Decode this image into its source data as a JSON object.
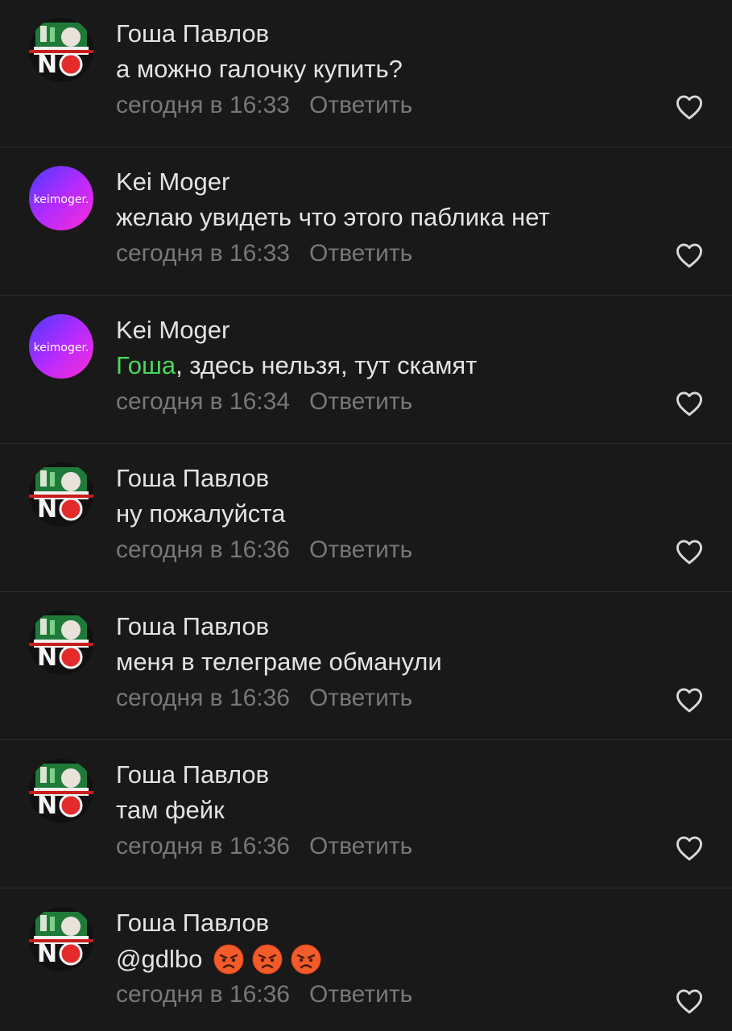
{
  "reply_label": "Ответить",
  "mention_color": "#4bd75b",
  "comments": [
    {
      "author": "Гоша Павлов",
      "avatar_icon": "no-sign-avatar-icon",
      "text": "а можно галочку купить?",
      "time": "сегодня в 16:33"
    },
    {
      "author": "Kei Moger",
      "avatar_icon": "keimoger-logo-avatar-icon",
      "avatar_text": "keimoger.",
      "text": "желаю увидеть что этого паблика нет",
      "time": "сегодня в 16:33"
    },
    {
      "author": "Kei Moger",
      "avatar_icon": "keimoger-logo-avatar-icon",
      "avatar_text": "keimoger.",
      "mention": "Гоша",
      "text": ", здесь нельзя, тут скамят",
      "time": "сегодня в 16:34"
    },
    {
      "author": "Гоша Павлов",
      "avatar_icon": "no-sign-avatar-icon",
      "text": "ну пожалуйста",
      "time": "сегодня в 16:36"
    },
    {
      "author": "Гоша Павлов",
      "avatar_icon": "no-sign-avatar-icon",
      "text": "меня в телеграме обманули",
      "time": "сегодня в 16:36"
    },
    {
      "author": "Гоша Павлов",
      "avatar_icon": "no-sign-avatar-icon",
      "text": "там фейк",
      "time": "сегодня в 16:36"
    },
    {
      "author": "Гоша Павлов",
      "avatar_icon": "no-sign-avatar-icon",
      "text": "@gdlbo",
      "emojis": [
        "angry-face-emoji-icon",
        "angry-face-emoji-icon",
        "angry-face-emoji-icon"
      ],
      "time": "сегодня в 16:36"
    }
  ]
}
